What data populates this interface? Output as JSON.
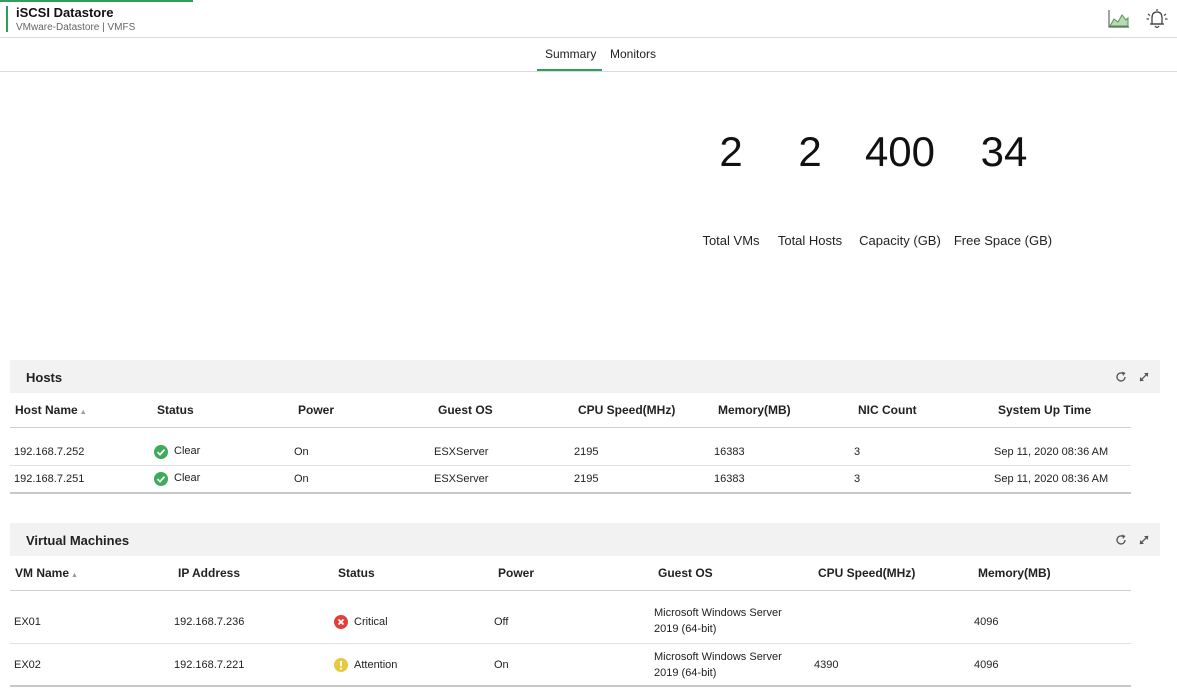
{
  "header": {
    "title": "iSCSI Datastore",
    "subtitle": "VMware-Datastore | VMFS",
    "icons": [
      "graph-icon",
      "alarm-bell-icon"
    ],
    "accent_color": "#2e9e5b"
  },
  "tabs": [
    {
      "label": "Summary",
      "active": true
    },
    {
      "label": "Monitors",
      "active": false
    }
  ],
  "stats": [
    {
      "value": "2",
      "label": "Total VMs"
    },
    {
      "value": "2",
      "label": "Total Hosts"
    },
    {
      "value": "400",
      "label": "Capacity (GB)"
    },
    {
      "value": "34",
      "label": "Free Space (GB)"
    }
  ],
  "hosts": {
    "title": "Hosts",
    "columns": [
      "Host Name",
      "Status",
      "Power",
      "Guest OS",
      "CPU Speed(MHz)",
      "Memory(MB)",
      "NIC Count",
      "System Up Time"
    ],
    "rows": [
      {
        "host": "192.168.7.252",
        "status": "Clear",
        "status_type": "clear",
        "power": "On",
        "os": "ESXServer",
        "cpu": "2195",
        "memory": "16383",
        "nic": "3",
        "uptime": "Sep 11, 2020 08:36 AM"
      },
      {
        "host": "192.168.7.251",
        "status": "Clear",
        "status_type": "clear",
        "power": "On",
        "os": "ESXServer",
        "cpu": "2195",
        "memory": "16383",
        "nic": "3",
        "uptime": "Sep 11, 2020 08:36 AM"
      }
    ]
  },
  "vms": {
    "title": "Virtual Machines",
    "columns": [
      "VM Name",
      "IP Address",
      "Status",
      "Power",
      "Guest OS",
      "CPU Speed(MHz)",
      "Memory(MB)"
    ],
    "rows": [
      {
        "name": "EX01",
        "ip": "192.168.7.236",
        "status": "Critical",
        "status_type": "critical",
        "power": "Off",
        "os_line1": "Microsoft Windows Server",
        "os_line2": "2019 (64-bit)",
        "cpu": "",
        "memory": "4096"
      },
      {
        "name": "EX02",
        "ip": "192.168.7.221",
        "status": "Attention",
        "status_type": "attention",
        "power": "On",
        "os_line1": "Microsoft Windows Server",
        "os_line2": "2019 (64-bit)",
        "cpu": "4390",
        "memory": "4096"
      }
    ]
  },
  "status_colors": {
    "clear": "#3cab5a",
    "critical": "#e0403c",
    "attention": "#e8c840"
  }
}
